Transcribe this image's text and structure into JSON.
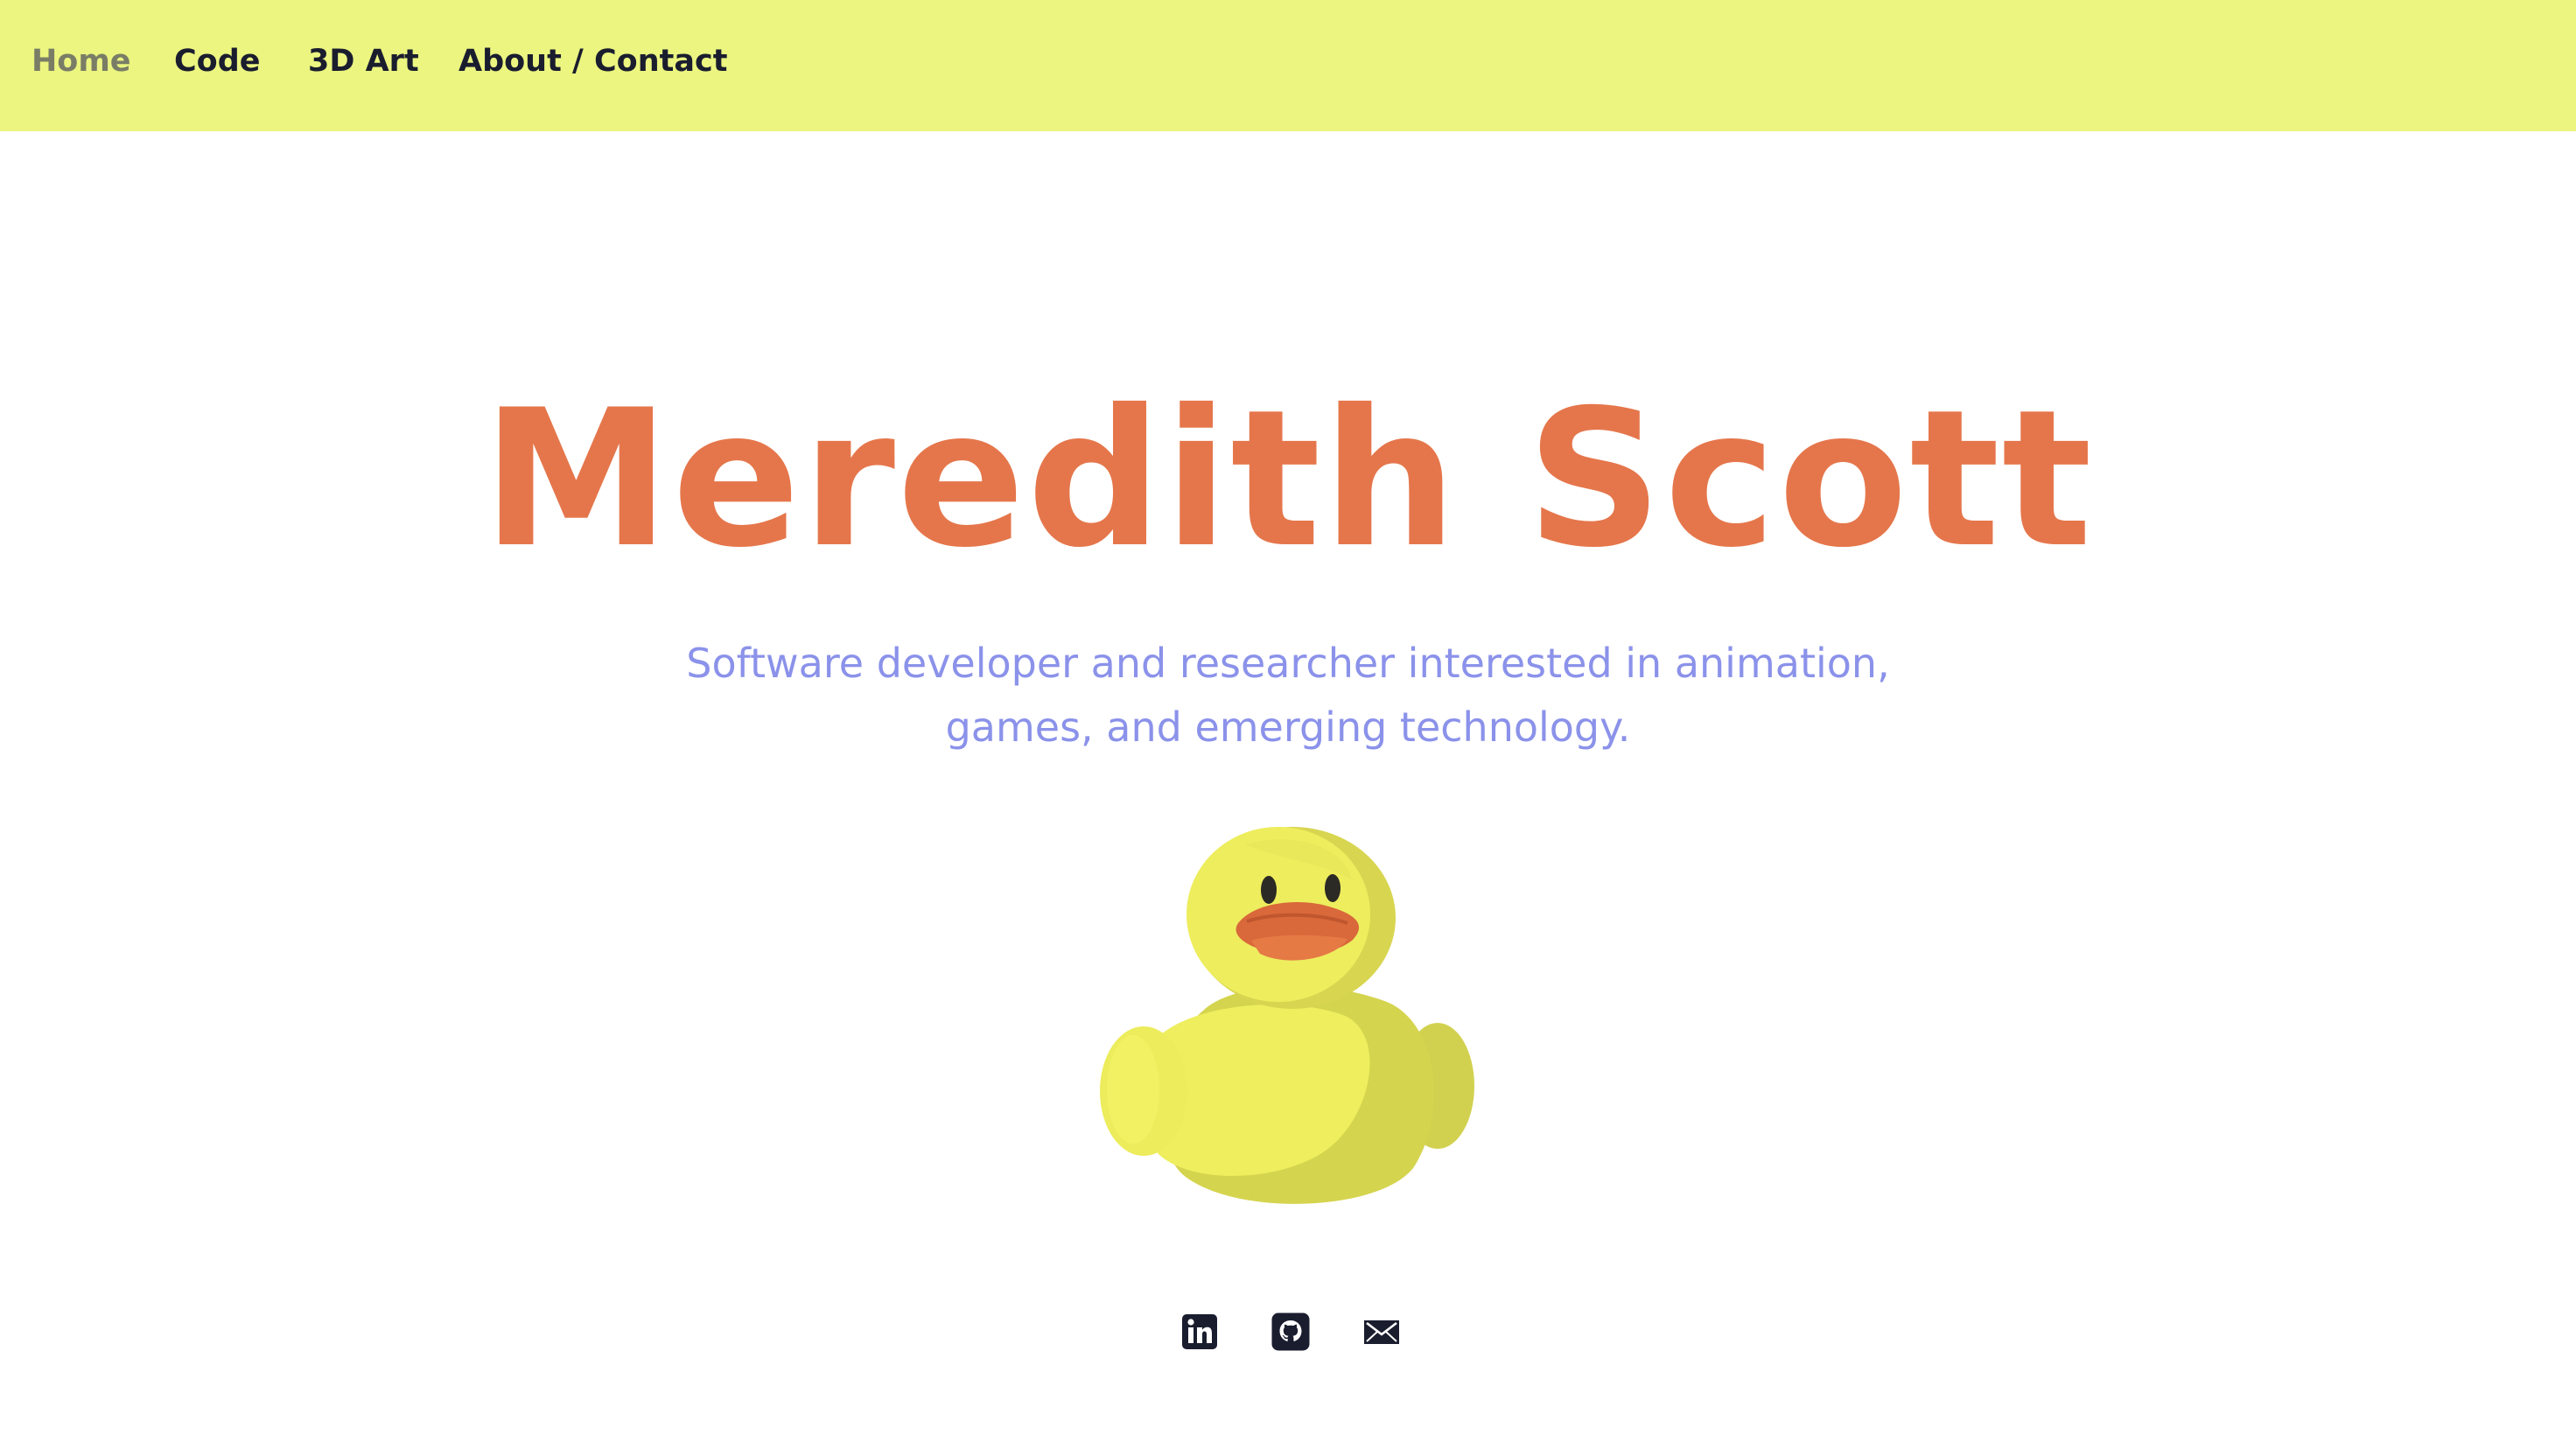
{
  "nav": {
    "items": [
      {
        "label": "Home",
        "active": true
      },
      {
        "label": "Code",
        "active": false
      },
      {
        "label": "3D Art",
        "active": false
      },
      {
        "label": "About / Contact",
        "active": false
      }
    ]
  },
  "hero": {
    "title": "Meredith Scott",
    "tagline_line1": "Software developer and researcher interested in animation,",
    "tagline_line2": "games, and emerging technology."
  },
  "social": {
    "icons": [
      "linkedin-icon",
      "github-icon",
      "mail-icon"
    ]
  },
  "colors": {
    "nav_bg": "#ebf580",
    "title": "#e5764b",
    "tagline": "#8b92ea",
    "nav_text": "#1a1d2e",
    "nav_active": "#7a7d66"
  }
}
